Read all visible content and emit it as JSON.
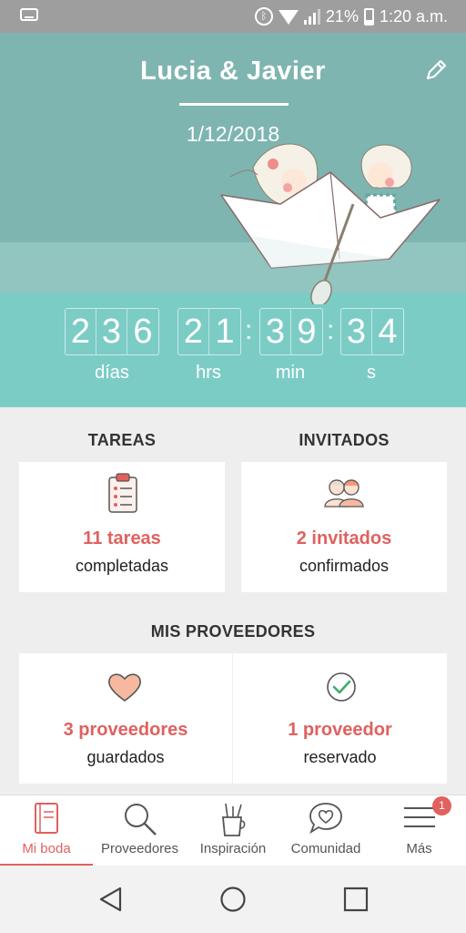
{
  "status_bar": {
    "battery": "21%",
    "time": "1:20 a.m.",
    "icons": [
      "voicemail-icon",
      "bluetooth-icon",
      "wifi-icon",
      "signal-icon",
      "battery-icon"
    ]
  },
  "header": {
    "couple": "Lucia & Javier",
    "date": "1/12/2018",
    "edit_icon": "pencil-icon"
  },
  "countdown": {
    "days": [
      "2",
      "3",
      "6"
    ],
    "hours": [
      "2",
      "1"
    ],
    "minutes": [
      "3",
      "9"
    ],
    "seconds": [
      "3",
      "4"
    ],
    "labels": {
      "days": "días",
      "hours": "hrs",
      "minutes": "min",
      "seconds": "s"
    }
  },
  "tasks": {
    "title": "TAREAS",
    "count": "11 tareas",
    "sub": "completadas",
    "icon": "clipboard-icon"
  },
  "guests": {
    "title": "INVITADOS",
    "count": "2 invitados",
    "sub": "confirmados",
    "icon": "guests-icon"
  },
  "vendors": {
    "title": "MIS PROVEEDORES",
    "saved_count": "3 proveedores",
    "saved_sub": "guardados",
    "booked_count": "1 proveedor",
    "booked_sub": "reservado"
  },
  "bottom_nav": {
    "items": [
      {
        "label": "Mi boda",
        "icon": "notebook-icon",
        "active": true
      },
      {
        "label": "Proveedores",
        "icon": "search-icon"
      },
      {
        "label": "Inspiración",
        "icon": "brushes-icon"
      },
      {
        "label": "Comunidad",
        "icon": "chat-heart-icon"
      },
      {
        "label": "Más",
        "icon": "menu-icon"
      }
    ],
    "badge": "1"
  },
  "colors": {
    "accent": "#e0615f",
    "header_teal": "#7fb5b0",
    "sea_teal": "#7cccc6",
    "heart_fill": "#f6b9a0"
  }
}
